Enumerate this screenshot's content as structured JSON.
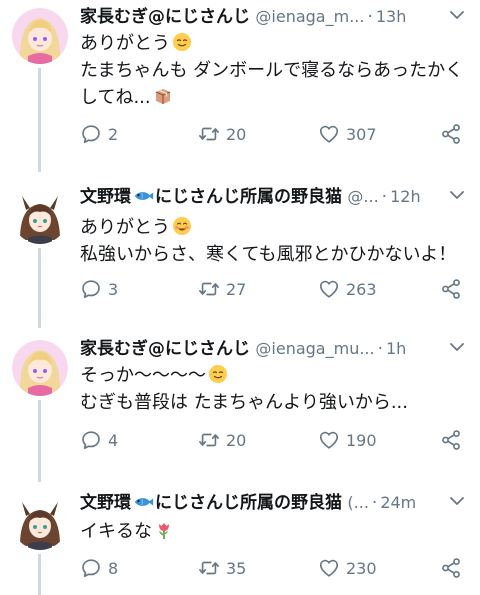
{
  "tweets": [
    {
      "name": "家長むぎ@にじさんじ",
      "handle": "@ienaga_m...",
      "time": "13h",
      "lines": [
        "ありがとう",
        "たまちゃんも ダンボールで寝るならあったかく",
        "してね..."
      ],
      "emojis": [
        "relieved-face-emoji",
        "package-emoji"
      ],
      "replies": "2",
      "retweets": "20",
      "likes": "307"
    },
    {
      "name": "文野環",
      "name_suffix": "にじさんじ所属の野良猫",
      "handle": "@...",
      "time": "12h",
      "lines": [
        "ありがとう",
        "私強いからさ、寒くても風邪とかひかないよ！"
      ],
      "emojis": [
        "smiling-face-emoji",
        "fish-emoji"
      ],
      "replies": "3",
      "retweets": "27",
      "likes": "263"
    },
    {
      "name": "家長むぎ@にじさんじ",
      "handle": "@ienaga_mu...",
      "time": "1h",
      "lines": [
        "そっか〜〜〜〜",
        "むぎも普段は たまちゃんより強いから..."
      ],
      "emojis": [
        "relieved-face-emoji"
      ],
      "replies": "4",
      "retweets": "20",
      "likes": "190"
    },
    {
      "name": "文野環",
      "name_suffix": "にじさんじ所属の野良猫",
      "handle": "(...",
      "time": "24m",
      "lines": [
        "イキるな"
      ],
      "emojis": [
        "tulip-emoji",
        "fish-emoji"
      ],
      "replies": "8",
      "retweets": "35",
      "likes": "230"
    }
  ],
  "colors": {
    "text": "#14171a",
    "secondary": "#657786",
    "thread_line": "#cfd9de"
  }
}
